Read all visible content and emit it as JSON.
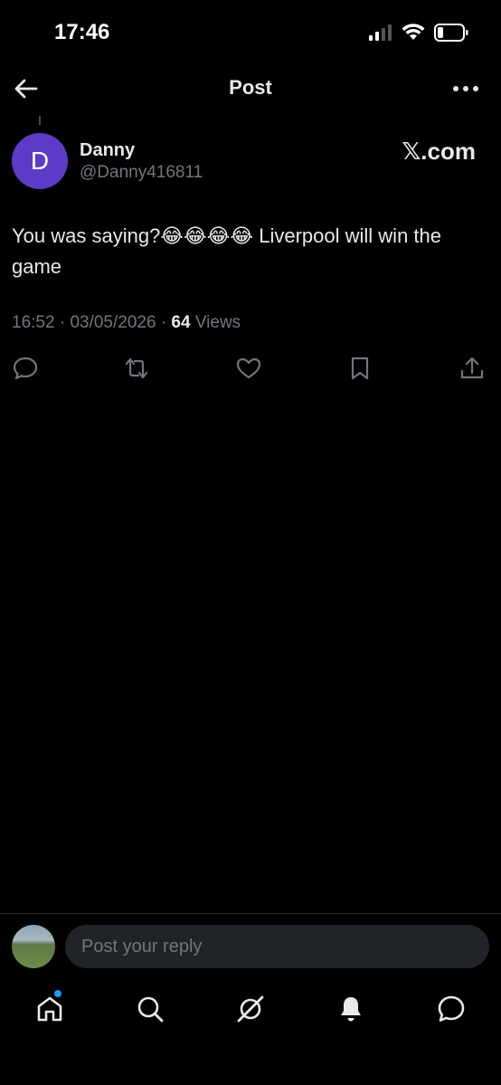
{
  "status_bar": {
    "time": "17:46",
    "icons": [
      "signal-icon",
      "wifi-icon",
      "battery-icon"
    ]
  },
  "header": {
    "title": "Post",
    "back_icon": "arrow-left-icon",
    "more_icon": "more-horizontal-icon"
  },
  "post": {
    "avatar_letter": "D",
    "author_name": "Danny",
    "author_handle": "@Danny416811",
    "watermark": "𝕏.com",
    "text": "You was saying?😂😂😂😂 Liverpool will win the game",
    "time": "16:52",
    "separator": "·",
    "date": "03/05/2026",
    "views_count": "64",
    "views_label": "Views",
    "actions": [
      "reply-icon",
      "repost-icon",
      "like-icon",
      "bookmark-icon",
      "share-icon"
    ]
  },
  "reply_bar": {
    "placeholder": "Post your reply"
  },
  "bottom_nav": {
    "items": [
      "home-icon",
      "search-icon",
      "grok-icon",
      "notifications-icon",
      "messages-icon"
    ]
  },
  "colors": {
    "background": "#000000",
    "text": "#e7e9ea",
    "muted": "#71767b",
    "avatar": "#5c3cc7",
    "accent": "#1d9bf0"
  }
}
